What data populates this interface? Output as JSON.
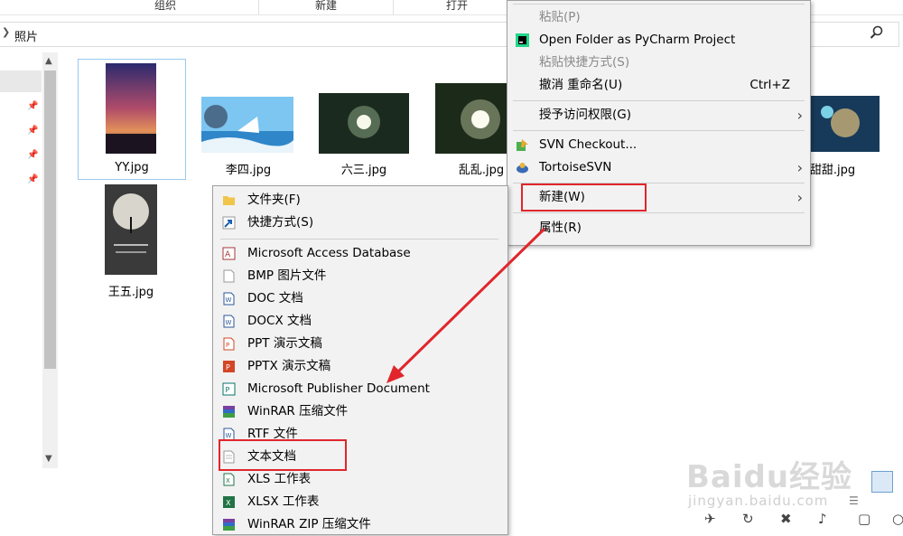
{
  "ribbon": {
    "groups": [
      "组织",
      "新建",
      "打开"
    ]
  },
  "address": {
    "path": "照片",
    "search_icon": "search-icon"
  },
  "files": [
    {
      "name": "YY.jpg",
      "selected": true
    },
    {
      "name": "李四.jpg"
    },
    {
      "name": "六三.jpg"
    },
    {
      "name": "乱乱.jpg"
    },
    {
      "name": "甜甜.jpg"
    },
    {
      "name": "王五.jpg"
    }
  ],
  "context_menu": {
    "items": [
      {
        "label": "粘贴(P)",
        "disabled": true
      },
      {
        "label": "Open Folder as PyCharm Project",
        "icon": "pycharm-icon"
      },
      {
        "label": "粘贴快捷方式(S)",
        "disabled": true
      },
      {
        "label": "撤消 重命名(U)",
        "shortcut": "Ctrl+Z"
      },
      {
        "label": "授予访问权限(G)",
        "submenu": true
      },
      {
        "label": "SVN Checkout...",
        "icon": "svn-checkout-icon"
      },
      {
        "label": "TortoiseSVN",
        "icon": "tortoisesvn-icon",
        "submenu": true
      },
      {
        "label": "新建(W)",
        "submenu": true,
        "highlighted": true
      },
      {
        "label": "属性(R)"
      }
    ]
  },
  "new_submenu": {
    "items": [
      {
        "label": "文件夹(F)",
        "icon": "folder-icon"
      },
      {
        "label": "快捷方式(S)",
        "icon": "shortcut-icon"
      },
      {
        "label": "Microsoft Access Database",
        "icon": "access-icon"
      },
      {
        "label": "BMP 图片文件",
        "icon": "bmp-icon"
      },
      {
        "label": "DOC 文档",
        "icon": "doc-icon"
      },
      {
        "label": "DOCX 文档",
        "icon": "docx-icon"
      },
      {
        "label": "PPT 演示文稿",
        "icon": "ppt-icon"
      },
      {
        "label": "PPTX 演示文稿",
        "icon": "pptx-icon"
      },
      {
        "label": "Microsoft Publisher Document",
        "icon": "publisher-icon"
      },
      {
        "label": "WinRAR 压缩文件",
        "icon": "winrar-icon"
      },
      {
        "label": "RTF 文件",
        "icon": "rtf-icon"
      },
      {
        "label": "文本文档",
        "icon": "text-document-icon",
        "highlighted": true
      },
      {
        "label": "XLS 工作表",
        "icon": "xls-icon"
      },
      {
        "label": "XLSX 工作表",
        "icon": "xlsx-icon"
      },
      {
        "label": "WinRAR ZIP 压缩文件",
        "icon": "winrar-zip-icon"
      }
    ]
  },
  "annotation": {
    "arrow_color": "#e0262c",
    "box_color": "#e0262c"
  },
  "watermark": {
    "logo": "Baidu经验",
    "url": "jingyan.baidu.com"
  }
}
